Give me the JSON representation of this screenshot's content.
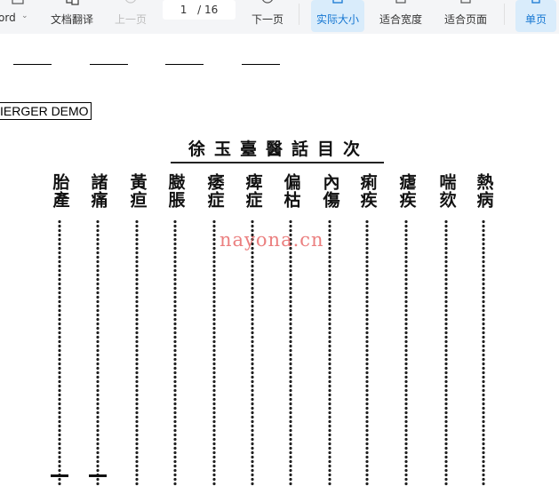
{
  "toolbar": {
    "word_label": "ord",
    "translate_label": "文档翻译",
    "prev_label": "上一页",
    "page_current": "1",
    "page_total": "/ 16",
    "next_label": "下一页",
    "actual_size_label": "实际大小",
    "fit_width_label": "适合宽度",
    "fit_page_label": "适合页面",
    "single_page_label": "单页",
    "accent_color": "#1677d2"
  },
  "document": {
    "demo_text": "IERGER DEMO",
    "scan_title": "徐玉臺醫話目次",
    "watermark": "nayona.cn",
    "toc_terms": [
      "熱病",
      "喘欬",
      "瘧疾",
      "痢疾",
      "內傷",
      "偏枯",
      "痺症",
      "痿症",
      "臌脹",
      "黃疸",
      "諸痛",
      "胎產"
    ]
  }
}
